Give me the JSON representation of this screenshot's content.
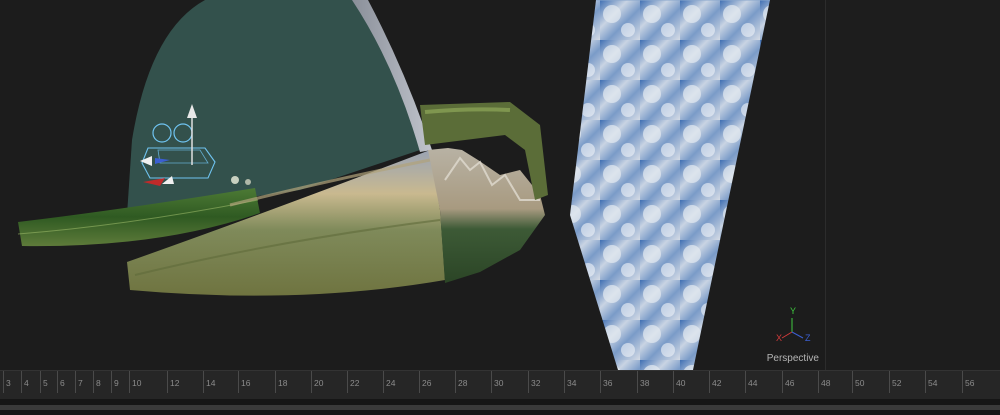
{
  "viewport": {
    "label": "Perspective",
    "axes": {
      "x": "X",
      "y": "Y",
      "z": "Z"
    },
    "colors": {
      "x_axis": "#d13b3b",
      "y_axis": "#3fc83f",
      "z_axis": "#3b5fd1",
      "sky_bg": "#33514c"
    },
    "objects": [
      "sky-dome",
      "landscape-strip",
      "mountain-strip",
      "sky-image-plane",
      "camera-gizmo"
    ]
  },
  "timeline": {
    "ticks": [
      "3",
      "4",
      "5",
      "6",
      "7",
      "8",
      "9",
      "10",
      "12",
      "14",
      "16",
      "18",
      "20",
      "22",
      "24",
      "26",
      "28",
      "30",
      "32",
      "34",
      "36",
      "38",
      "40",
      "42",
      "44",
      "46",
      "48",
      "50",
      "52",
      "54",
      "56"
    ]
  }
}
